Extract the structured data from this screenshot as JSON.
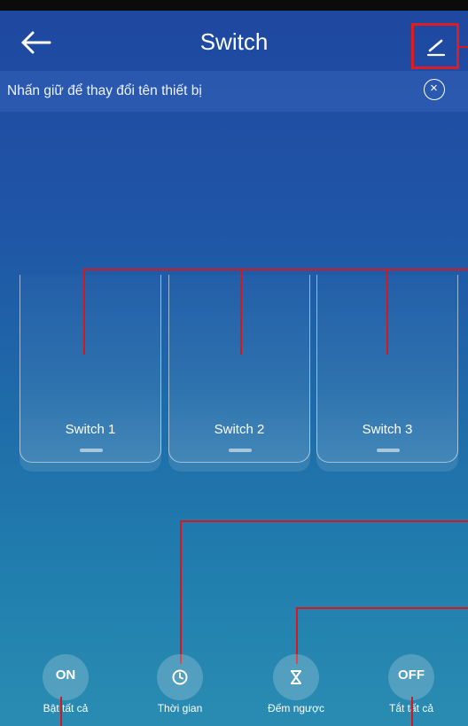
{
  "header": {
    "title": "Switch",
    "back_icon": "arrow-left-icon",
    "edit_icon": "pencil-icon"
  },
  "hint": {
    "text": "Nhấn giữ để thay đổi tên thiết bị",
    "close_symbol": "×"
  },
  "switches": [
    {
      "label": "Switch 1"
    },
    {
      "label": "Switch 2"
    },
    {
      "label": "Switch 3"
    }
  ],
  "actions": [
    {
      "label": "Bật tất cả",
      "icon_text": "ON"
    },
    {
      "label": "Thời gian",
      "icon": "clock-icon"
    },
    {
      "label": "Đếm ngược",
      "icon": "hourglass-icon"
    },
    {
      "label": "Tắt tất cả",
      "icon_text": "OFF"
    }
  ],
  "colors": {
    "annotation": "#d7171c",
    "bg_top": "#1f47a0",
    "bg_bottom": "#2a8cb2"
  }
}
